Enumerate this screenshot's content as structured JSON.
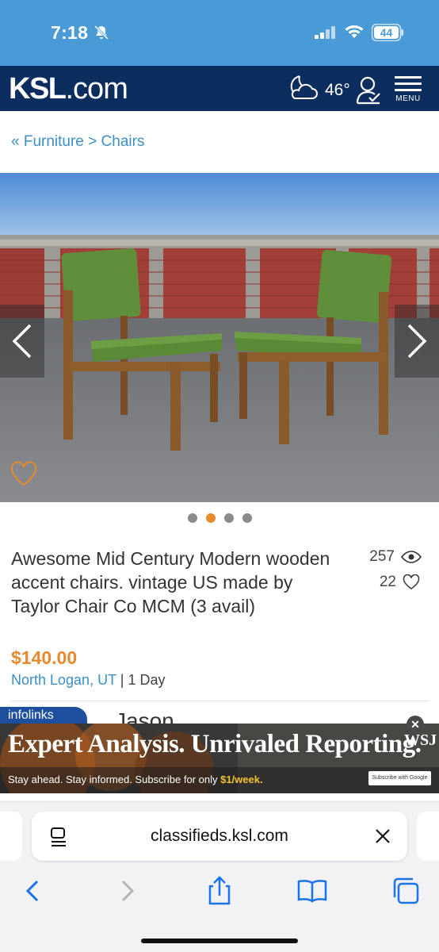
{
  "status_bar": {
    "time": "7:18",
    "battery": "44"
  },
  "header": {
    "logo_main": "KSL",
    "logo_suffix": ".com",
    "temperature": "46°",
    "menu_label": "MENU"
  },
  "breadcrumb": "« Furniture > Chairs",
  "carousel": {
    "total_photos": 4,
    "active_index": 1
  },
  "listing": {
    "title": "Awesome Mid Century Modern wooden accent chairs. vintage US made by Taylor Chair Co MCM (3 avail)",
    "views": "257",
    "favorites": "22",
    "price": "$140.00",
    "location": "North Logan, UT",
    "separator": "|",
    "posted": "1 Day",
    "seller_name": "Jason"
  },
  "ad": {
    "network": "infolinks",
    "headline": "Expert Analysis. Unrivaled Reporting.",
    "subline": "Stay ahead. Stay informed. Subscribe for only ",
    "price": "$1/week.",
    "brand": "WSJ",
    "subscribe_label": "Subscribe with Google",
    "close_glyph": "✕"
  },
  "safari": {
    "url": "classifieds.ksl.com"
  },
  "colors": {
    "ksl_navy": "#0c2e5e",
    "status_blue": "#4a9ad8",
    "link_blue": "#3b8fc7",
    "price_orange": "#e68a2e"
  }
}
